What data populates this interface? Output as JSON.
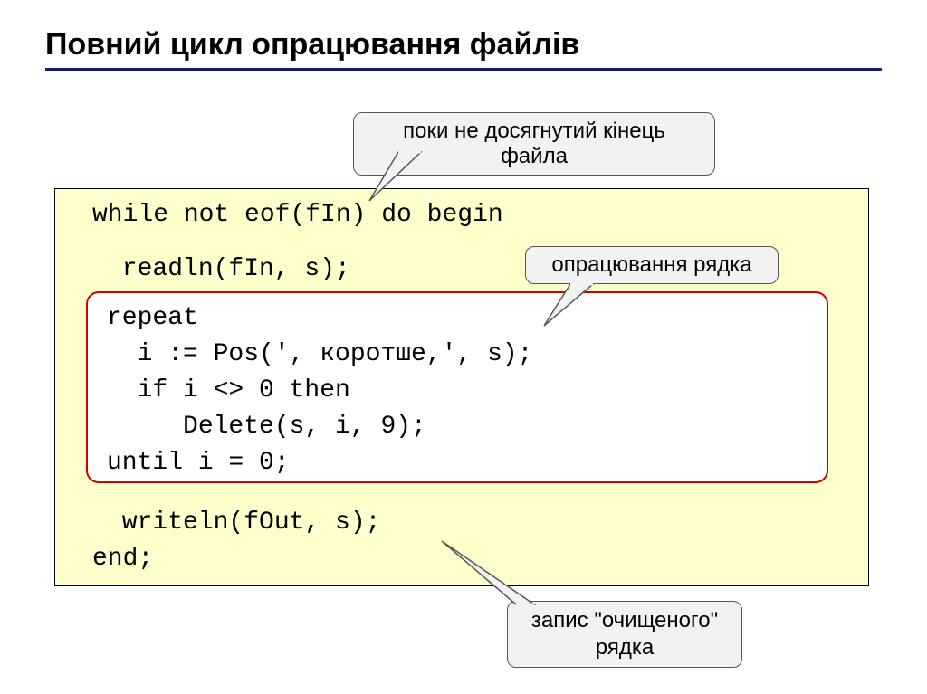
{
  "title": "Повний цикл опрацювання файлів",
  "callouts": {
    "top": "поки не досягнутий кінець файла",
    "right": "опрацювання рядка",
    "bottom_l1": "запис \"очищеного\"",
    "bottom_l2": "рядка"
  },
  "code": {
    "l1": "while not eof(fIn) do begin",
    "l2": " readln(fIn, s);",
    "l3": "repeat",
    "l4": "  i := Pos(', коротше,', s);",
    "l5": "  if i <> 0 then",
    "l6": "     Delete(s, i, 9);",
    "l7": "until i = 0;",
    "l8": " writeln(fOut, s);",
    "l9": "end;"
  }
}
